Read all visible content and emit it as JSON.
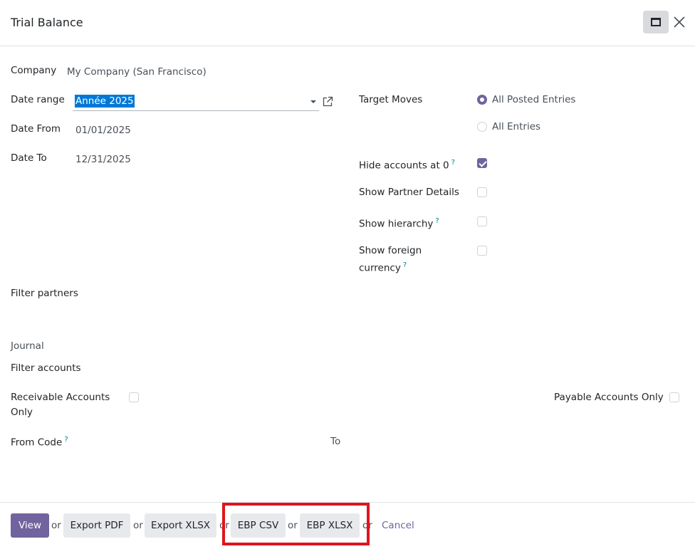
{
  "dialog": {
    "title": "Trial Balance"
  },
  "form": {
    "company": {
      "label": "Company",
      "value": "My Company (San Francisco)"
    },
    "date_range": {
      "label": "Date range",
      "value": "Année 2025"
    },
    "date_from": {
      "label": "Date From",
      "value": "01/01/2025"
    },
    "date_to": {
      "label": "Date To",
      "value": "12/31/2025"
    },
    "target_moves": {
      "label": "Target Moves",
      "options": [
        {
          "label": "All Posted Entries",
          "selected": true
        },
        {
          "label": "All Entries",
          "selected": false
        }
      ]
    },
    "hide_accounts_zero": {
      "label": "Hide accounts at 0",
      "help": "?",
      "checked": true
    },
    "show_partner_details": {
      "label": "Show Partner Details",
      "checked": false
    },
    "show_hierarchy": {
      "label": "Show hierarchy",
      "help": "?",
      "checked": false
    },
    "show_foreign_currency": {
      "label_line1": "Show foreign",
      "label_line2": "currency",
      "help": "?",
      "checked": false
    },
    "filter_partners": {
      "label": "Filter partners"
    },
    "journal": {
      "label": "Journal"
    },
    "filter_accounts": {
      "label": "Filter accounts"
    },
    "receivable_only": {
      "label_line1": "Receivable Accounts",
      "label_line2": "Only",
      "checked": false
    },
    "payable_only": {
      "label": "Payable Accounts Only",
      "checked": false
    },
    "from_code": {
      "label": "From Code",
      "help": "?"
    },
    "to_code": {
      "label": "To"
    }
  },
  "footer": {
    "view": "View",
    "export_pdf": "Export PDF",
    "export_xlsx": "Export XLSX",
    "ebp_csv": "EBP CSV",
    "ebp_xlsx": "EBP XLSX",
    "cancel": "Cancel",
    "or": "or"
  },
  "colors": {
    "primary": "#71639e",
    "highlight": "#e0141e",
    "selection": "#0078d7"
  }
}
